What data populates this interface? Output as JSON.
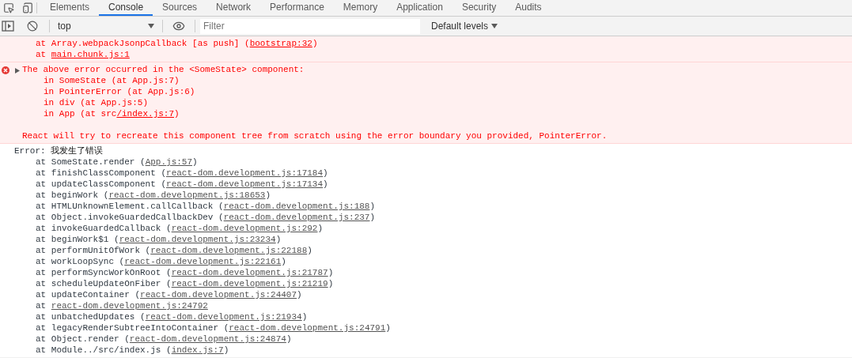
{
  "tabs": [
    {
      "label": "Elements",
      "selected": false
    },
    {
      "label": "Console",
      "selected": true
    },
    {
      "label": "Sources",
      "selected": false
    },
    {
      "label": "Network",
      "selected": false
    },
    {
      "label": "Performance",
      "selected": false
    },
    {
      "label": "Memory",
      "selected": false
    },
    {
      "label": "Application",
      "selected": false
    },
    {
      "label": "Security",
      "selected": false
    },
    {
      "label": "Audits",
      "selected": false
    }
  ],
  "toolbar": {
    "context": "top",
    "filter": {
      "placeholder": "Filter"
    },
    "levels": "Default levels"
  },
  "messages": [
    {
      "kind": "error",
      "lines": [
        {
          "kind": "frame",
          "text": "at Array.webpackJsonpCallback [as push] (",
          "link": "bootstrap:32",
          "after": ")"
        },
        {
          "kind": "frame",
          "text": "at ",
          "link": "main.chunk.js:1"
        }
      ]
    },
    {
      "kind": "error",
      "expanded": false,
      "lines": [
        {
          "kind": "head",
          "text": "The above error occurred in the <SomeState> component:"
        },
        {
          "kind": "frame",
          "text": "in SomeState (at App.js:7)"
        },
        {
          "kind": "frame",
          "text": "in PointerError (at App.js:6)"
        },
        {
          "kind": "frame",
          "text": "in div (at App.js:5)"
        },
        {
          "kind": "frame",
          "text": "in App (at src",
          "link": "/index.js:7",
          "after": ")"
        },
        {
          "kind": "gap"
        },
        {
          "kind": "head",
          "text": "React will try to recreate this component tree from scratch using the error boundary you provided, PointerError."
        }
      ]
    },
    {
      "kind": "log",
      "lines": [
        {
          "kind": "head",
          "text": "Error: ",
          "cjk": "我发生了错误"
        },
        {
          "kind": "frame",
          "text": "at SomeState.render (",
          "link": "App.js:57",
          "after": ")"
        },
        {
          "kind": "frame",
          "text": "at finishClassComponent (",
          "link": "react-dom.development.js:17184",
          "after": ")"
        },
        {
          "kind": "frame",
          "text": "at updateClassComponent (",
          "link": "react-dom.development.js:17134",
          "after": ")"
        },
        {
          "kind": "frame",
          "text": "at beginWork (",
          "link": "react-dom.development.js:18653",
          "after": ")"
        },
        {
          "kind": "frame",
          "text": "at HTMLUnknownElement.callCallback (",
          "link": "react-dom.development.js:188",
          "after": ")"
        },
        {
          "kind": "frame",
          "text": "at Object.invokeGuardedCallbackDev (",
          "link": "react-dom.development.js:237",
          "after": ")"
        },
        {
          "kind": "frame",
          "text": "at invokeGuardedCallback (",
          "link": "react-dom.development.js:292",
          "after": ")"
        },
        {
          "kind": "frame",
          "text": "at beginWork$1 (",
          "link": "react-dom.development.js:23234",
          "after": ")"
        },
        {
          "kind": "frame",
          "text": "at performUnitOfWork (",
          "link": "react-dom.development.js:22188",
          "after": ")"
        },
        {
          "kind": "frame",
          "text": "at workLoopSync (",
          "link": "react-dom.development.js:22161",
          "after": ")"
        },
        {
          "kind": "frame",
          "text": "at performSyncWorkOnRoot (",
          "link": "react-dom.development.js:21787",
          "after": ")"
        },
        {
          "kind": "frame",
          "text": "at scheduleUpdateOnFiber (",
          "link": "react-dom.development.js:21219",
          "after": ")"
        },
        {
          "kind": "frame",
          "text": "at updateContainer (",
          "link": "react-dom.development.js:24407",
          "after": ")"
        },
        {
          "kind": "frame",
          "text": "at ",
          "link": "react-dom.development.js:24792"
        },
        {
          "kind": "frame",
          "text": "at unbatchedUpdates (",
          "link": "react-dom.development.js:21934",
          "after": ")"
        },
        {
          "kind": "frame",
          "text": "at legacyRenderSubtreeIntoContainer (",
          "link": "react-dom.development.js:24791",
          "after": ")"
        },
        {
          "kind": "frame",
          "text": "at Object.render (",
          "link": "react-dom.development.js:24874",
          "after": ")"
        },
        {
          "kind": "frame",
          "text": "at Module../src/index.js (",
          "link": "index.js:7",
          "after": ")"
        }
      ]
    }
  ]
}
